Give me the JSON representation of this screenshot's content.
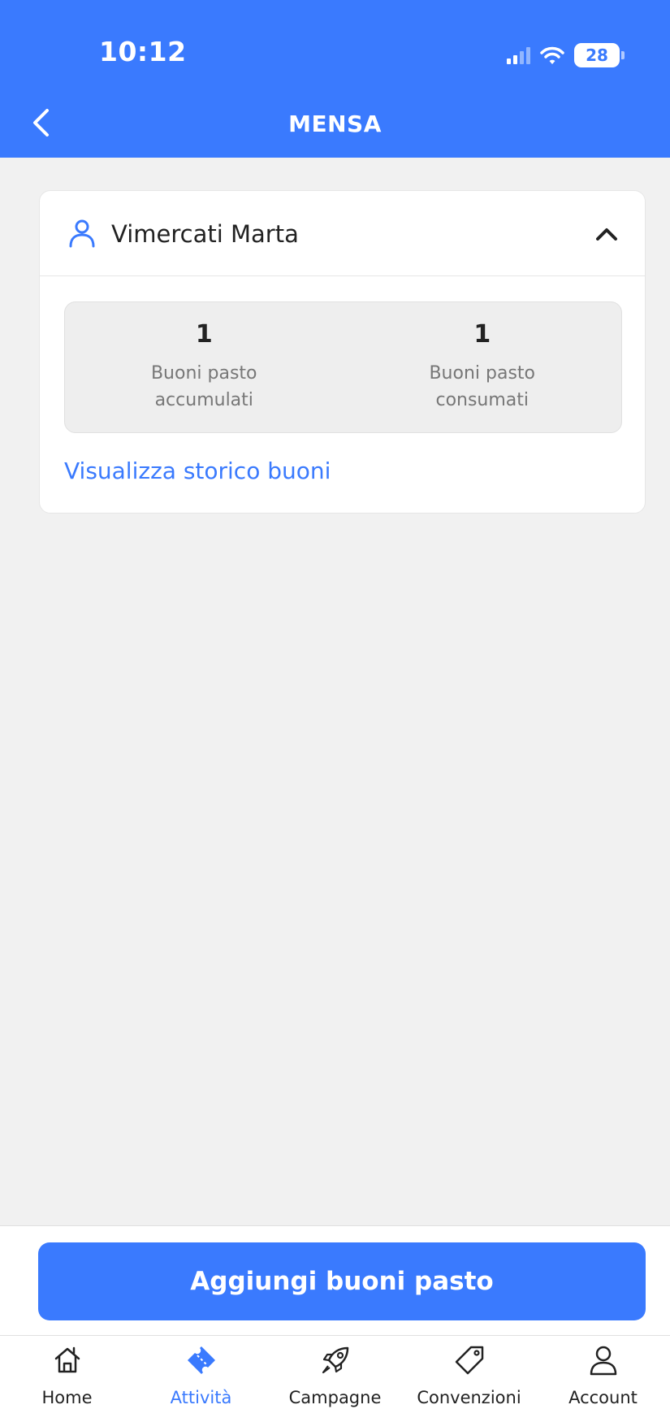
{
  "status_bar": {
    "time": "10:12",
    "battery": "28"
  },
  "header": {
    "title": "MENSA",
    "back_icon": "chevron-left-icon"
  },
  "card": {
    "user_icon": "user-icon",
    "user_name": "Vimercati Marta",
    "expand_icon": "chevron-up-icon",
    "stats": [
      {
        "value": "1",
        "label_line1": "Buoni pasto",
        "label_line2": "accumulati"
      },
      {
        "value": "1",
        "label_line1": "Buoni pasto",
        "label_line2": "consumati"
      }
    ],
    "history_link": "Visualizza storico buoni"
  },
  "primary_button": {
    "label": "Aggiungi buoni pasto"
  },
  "tab_bar": {
    "active": "Attività",
    "items": [
      {
        "label": "Home",
        "icon": "home-icon"
      },
      {
        "label": "Attività",
        "icon": "ticket-icon"
      },
      {
        "label": "Campagne",
        "icon": "rocket-icon"
      },
      {
        "label": "Convenzioni",
        "icon": "tag-icon"
      },
      {
        "label": "Account",
        "icon": "account-icon"
      }
    ]
  },
  "colors": {
    "accent": "#3a7afe",
    "background": "#f1f1f1",
    "card": "#ffffff",
    "stats_box": "#eeeeee"
  }
}
